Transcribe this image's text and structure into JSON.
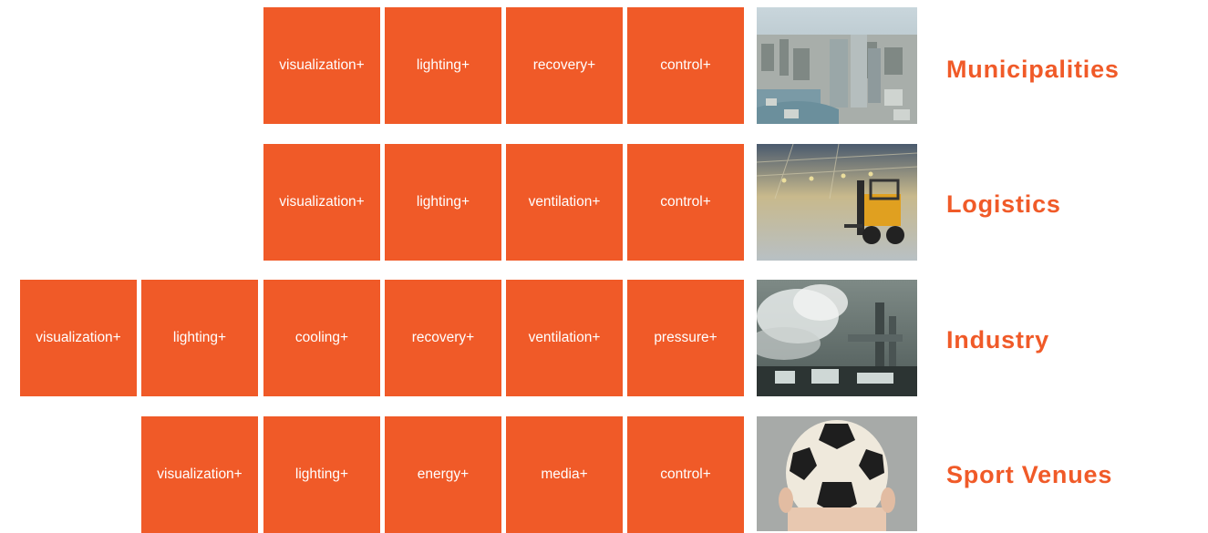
{
  "rows": [
    {
      "sector": "Municipalities",
      "image": "city-skyline-photo",
      "tiles": [
        "visualization+",
        "lighting+",
        "recovery+",
        "control+"
      ]
    },
    {
      "sector": "Logistics",
      "image": "warehouse-forklift-photo",
      "tiles": [
        "visualization+",
        "lighting+",
        "ventilation+",
        "control+"
      ]
    },
    {
      "sector": "Industry",
      "image": "industrial-plant-photo",
      "tiles": [
        "visualization+",
        "lighting+",
        "cooling+",
        "recovery+",
        "ventilation+",
        "pressure+"
      ]
    },
    {
      "sector": "Sport Venues",
      "image": "soccer-ball-haircut-photo",
      "tiles": [
        "visualization+",
        "lighting+",
        "energy+",
        "media+",
        "control+"
      ]
    }
  ],
  "colors": {
    "accent": "#f05a28",
    "tile_text": "#ffffff",
    "background": "#ffffff"
  }
}
